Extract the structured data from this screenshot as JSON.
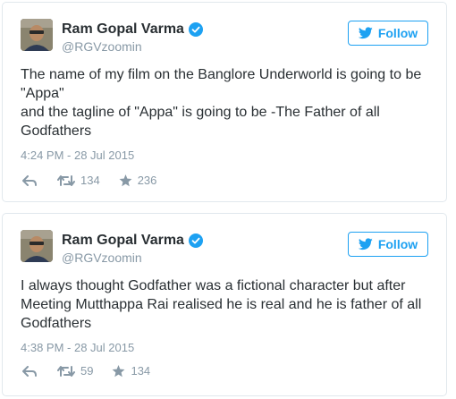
{
  "tweets": [
    {
      "display_name": "Ram Gopal Varma",
      "handle": "@RGVzoomin",
      "follow_label": "Follow",
      "text_lines": [
        "The name of my film on the Banglore Underworld is going to be",
        "\"Appa\"",
        "and the tagline of \"Appa\" is going to be -The Father of all",
        "Godfathers"
      ],
      "timestamp": "4:24 PM - 28 Jul 2015",
      "retweets": "134",
      "favorites": "236"
    },
    {
      "display_name": "Ram Gopal Varma",
      "handle": "@RGVzoomin",
      "follow_label": "Follow",
      "text_lines": [
        "I always thought Godfather was a fictional character but after",
        "Meeting Mutthappa Rai realised he is real and he is father of all",
        "Godfathers"
      ],
      "timestamp": "4:38 PM - 28 Jul 2015",
      "retweets": "59",
      "favorites": "134"
    }
  ],
  "colors": {
    "accent": "#1da1f2",
    "text": "#292f33",
    "muted": "#8899a6",
    "border": "#e1e8ed"
  },
  "icons": {
    "verified": "verified-badge-icon",
    "bird": "twitter-bird-icon",
    "reply": "reply-icon",
    "retweet": "retweet-icon",
    "favorite": "star-icon"
  }
}
